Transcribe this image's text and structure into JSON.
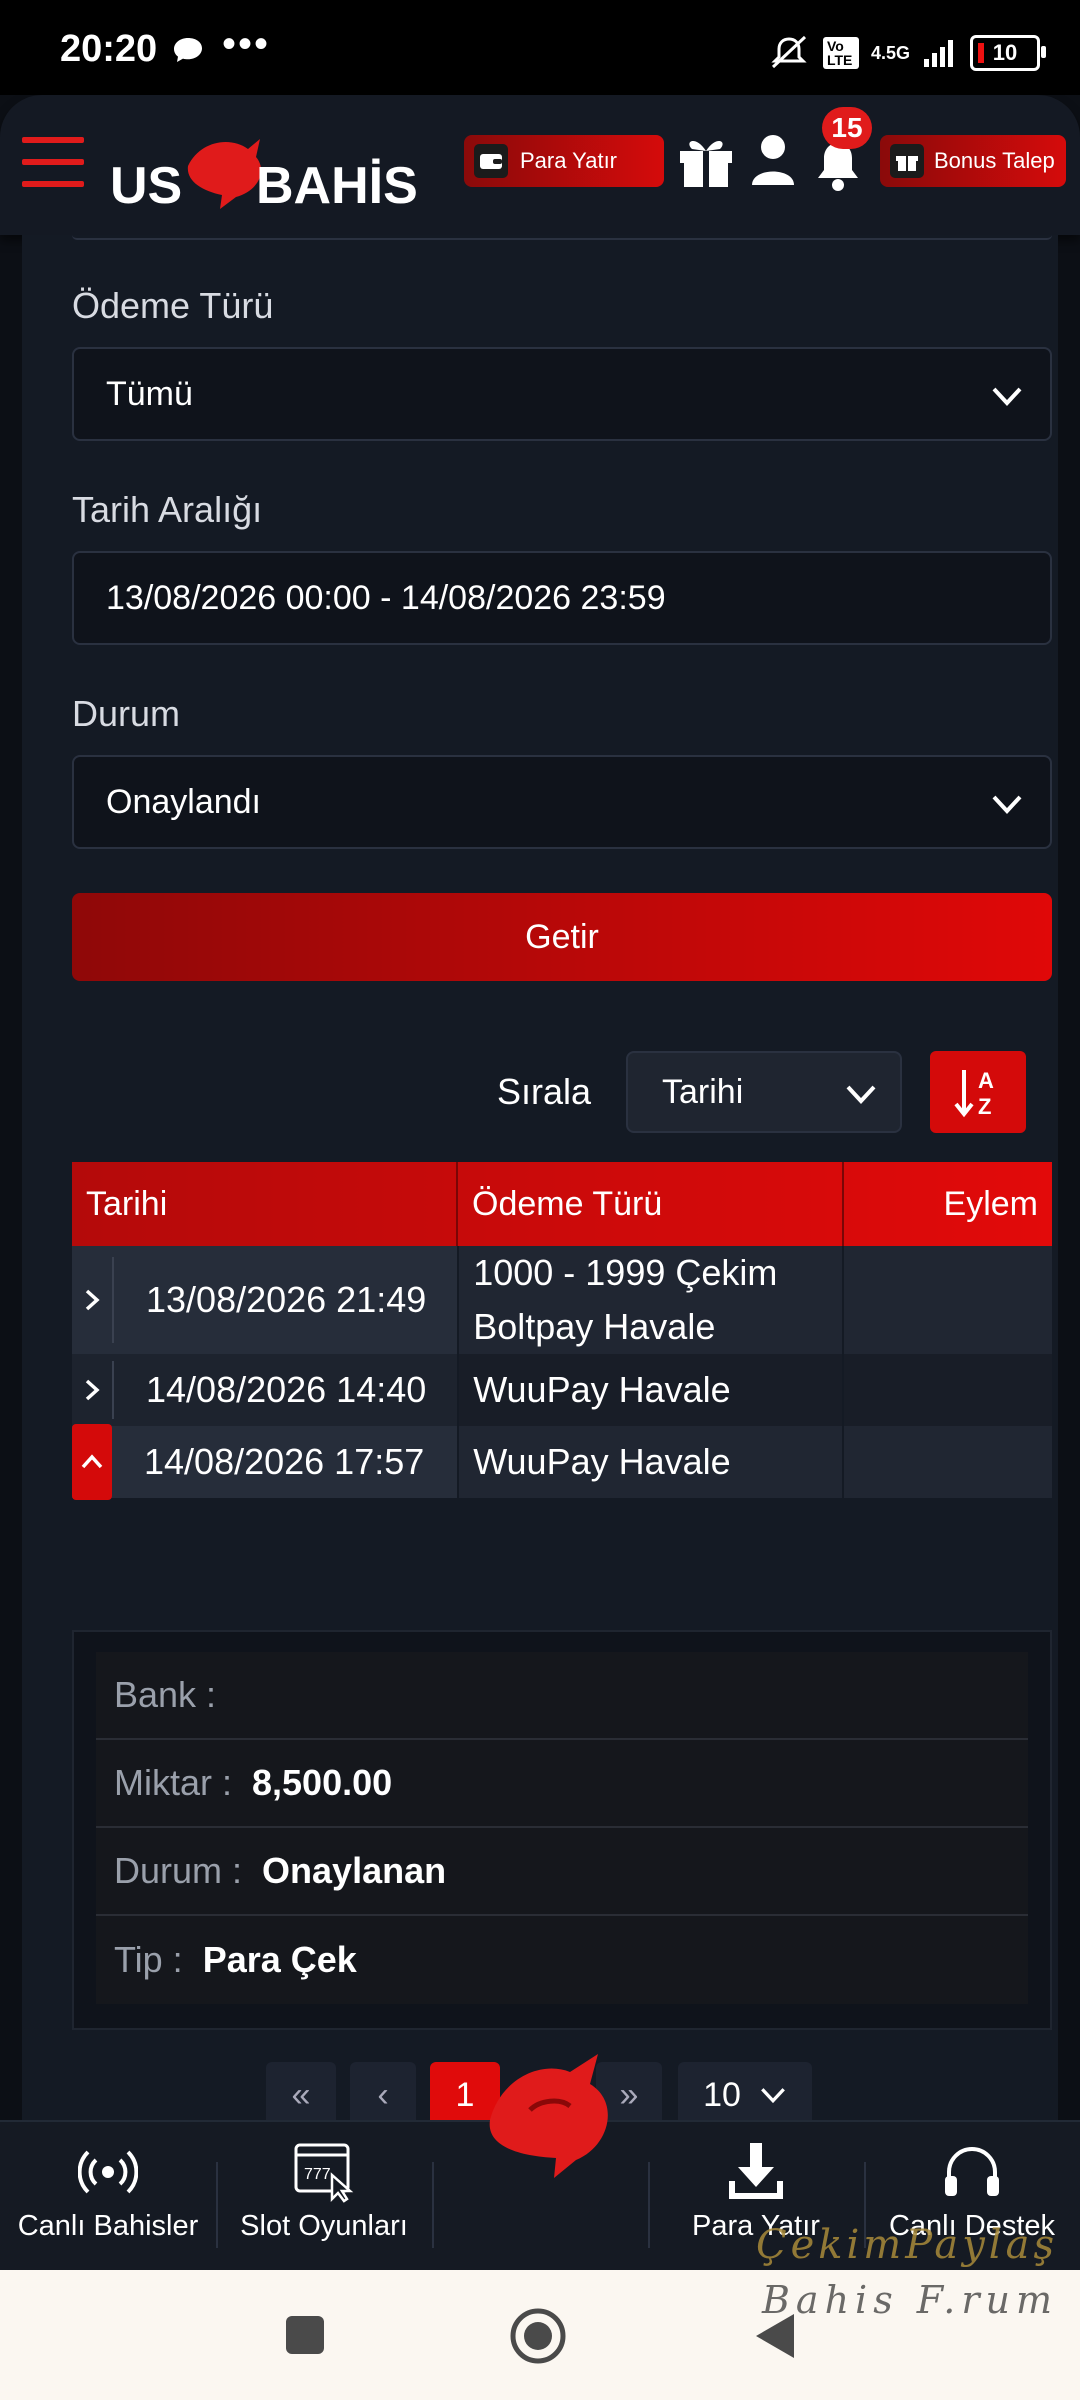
{
  "status_bar": {
    "time": "20:20",
    "dots": "•••",
    "network": "4.5G",
    "volte": "Vo LTE",
    "battery": "10"
  },
  "header": {
    "logo_text": "US BAHİS",
    "deposit_label": "Para Yatır",
    "notifications_count": "15",
    "bonus_label": "Bonus Talep"
  },
  "filters": {
    "payment_type_label": "Ödeme Türü",
    "payment_type_value": "Tümü",
    "date_range_label": "Tarih Aralığı",
    "date_range_value": "13/08/2026 00:00 - 14/08/2026 23:59",
    "status_label": "Durum",
    "status_value": "Onaylandı",
    "submit_label": "Getir"
  },
  "sort": {
    "label": "Sırala",
    "value": "Tarihi"
  },
  "table": {
    "headers": [
      "Tarihi",
      "Ödeme Türü",
      "Eylem"
    ],
    "rows": [
      {
        "date": "13/08/2026 21:49",
        "payment_line1": "1000 - 1999 Çekim",
        "payment_line2": "Boltpay Havale"
      },
      {
        "date": "14/08/2026 14:40",
        "payment_line1": "WuuPay Havale"
      },
      {
        "date": "14/08/2026 17:57",
        "payment_line1": "WuuPay Havale"
      }
    ]
  },
  "detail": {
    "bank_label": "Bank :",
    "bank_value": "",
    "amount_label": "Miktar :",
    "amount_value": "8,500.00",
    "status_label": "Durum :",
    "status_value": "Onaylanan",
    "type_label": "Tip :",
    "type_value": "Para Çek"
  },
  "pagination": {
    "first": "«",
    "prev": "‹",
    "current": "1",
    "last": "»",
    "page_size": "10"
  },
  "bottom_nav": {
    "live_bets": "Canlı Bahisler",
    "slots": "Slot Oyunları",
    "deposit": "Para Yatır",
    "live_support": "Canlı Destek"
  },
  "watermark": {
    "line1": "ÇekimPaylaş",
    "line2": "Bahis F.rum"
  },
  "colors": {
    "accent": "#e00b0b",
    "background": "#0c0f15",
    "panel": "#141a24"
  }
}
